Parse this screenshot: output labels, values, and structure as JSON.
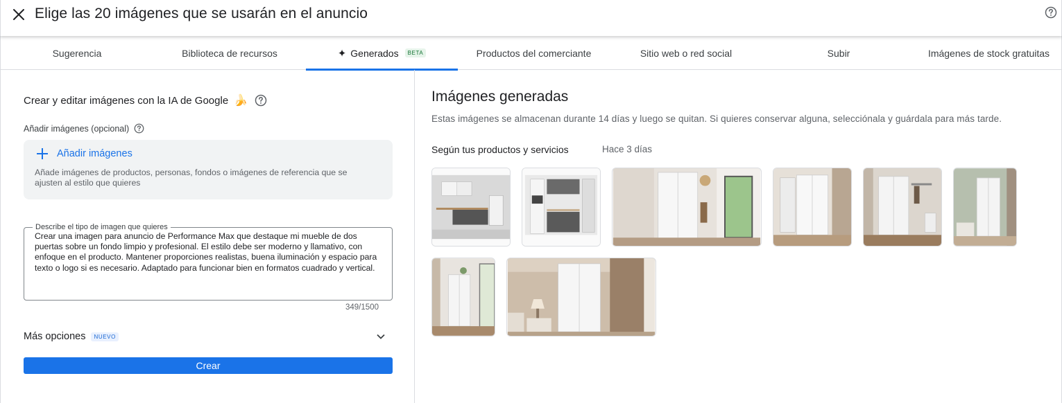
{
  "header": {
    "title": "Elige las 20 imágenes que se usarán en el anuncio"
  },
  "tabs": [
    {
      "label": "Sugerencia"
    },
    {
      "label": "Biblioteca de recursos"
    },
    {
      "label": "Generados",
      "badge": "BETA"
    },
    {
      "label": "Productos del comerciante"
    },
    {
      "label": "Sitio web o red social"
    },
    {
      "label": "Subir"
    },
    {
      "label": "Imágenes de stock gratuitas"
    }
  ],
  "left": {
    "section_title": "Crear y editar imágenes con la IA de Google",
    "add_label": "Añadir imágenes (opcional)",
    "add_button": "Añadir imágenes",
    "add_help": "Añade imágenes de productos, personas, fondos o imágenes de referencia que se ajusten al estilo que quieres",
    "prompt_label": "Describe el tipo de imagen que quieres",
    "prompt_value": "Crear una imagen para anuncio de Performance Max que destaque mi mueble de dos puertas sobre un fondo limpio y profesional. El estilo debe ser moderno y llamativo, con enfoque en el producto. Mantener proporciones realistas, buena iluminación y espacio para texto o logo si es necesario. Adaptado para funcionar bien en formatos cuadrado y vertical.",
    "counter": "349/1500",
    "more_options": "Más opciones",
    "more_badge": "NUEVO",
    "create_button": "Crear"
  },
  "right": {
    "title": "Imágenes generadas",
    "subtitle": "Estas imágenes se almacenan durante 14 días y luego se quitan. Si quieres conservar alguna, selecciónala y guárdala para más tarde.",
    "group_label": "Según tus productos y servicios",
    "group_time": "Hace 3 días"
  },
  "colors": {
    "accent": "#1a73e8",
    "beta_bg": "#e6f4ea",
    "beta_fg": "#137333",
    "nuevo_bg": "#e8f0fe",
    "nuevo_fg": "#1967d2"
  }
}
